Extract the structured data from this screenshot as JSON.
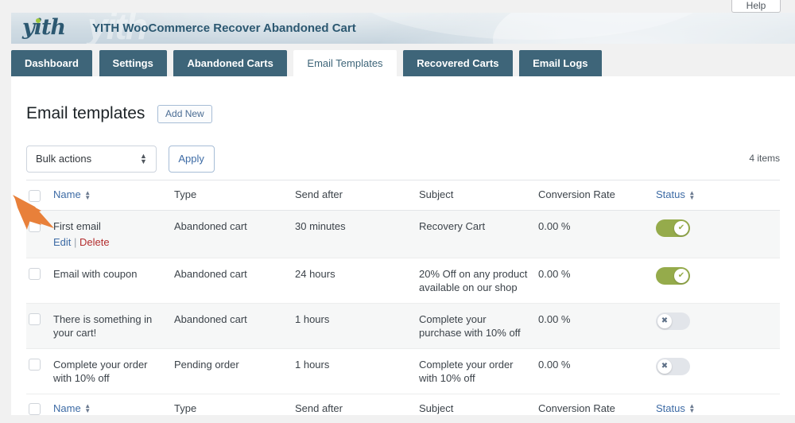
{
  "window": {
    "help_tab_label": "Help"
  },
  "banner": {
    "logo_text": "yith",
    "ghost_text": "yith",
    "title": "YITH WooCommerce Recover Abandoned Cart",
    "logo_color": "#2c5871",
    "logo_dot_color": "#9ec73d"
  },
  "tabs": [
    {
      "label": "Dashboard",
      "active": false
    },
    {
      "label": "Settings",
      "active": false
    },
    {
      "label": "Abandoned Carts",
      "active": false
    },
    {
      "label": "Email Templates",
      "active": true
    },
    {
      "label": "Recovered Carts",
      "active": false
    },
    {
      "label": "Email Logs",
      "active": false
    }
  ],
  "page": {
    "title": "Email templates",
    "add_new_label": "Add New"
  },
  "bulk": {
    "select_value": "Bulk actions",
    "select_icon": "up-down-arrows-icon",
    "apply_label": "Apply",
    "items_count": "4 items"
  },
  "table": {
    "columns": [
      {
        "label": "Name",
        "sortable": true
      },
      {
        "label": "Type",
        "sortable": false
      },
      {
        "label": "Send after",
        "sortable": false
      },
      {
        "label": "Subject",
        "sortable": false
      },
      {
        "label": "Conversion Rate",
        "sortable": false
      },
      {
        "label": "Status",
        "sortable": true
      }
    ],
    "row_actions": {
      "edit_label": "Edit",
      "separator": "|",
      "delete_label": "Delete"
    },
    "rows": [
      {
        "name": "First email",
        "type": "Abandoned cart",
        "send_after": "30 minutes",
        "subject": "Recovery Cart",
        "conversion_rate": "0.00 %",
        "status_on": true,
        "status_icon": "check-icon",
        "has_actions": true
      },
      {
        "name": "Email with coupon",
        "type": "Abandoned cart",
        "send_after": "24 hours",
        "subject": "20% Off on any product available on our shop",
        "conversion_rate": "0.00 %",
        "status_on": true,
        "status_icon": "check-icon",
        "has_actions": false
      },
      {
        "name": "There is something in your cart!",
        "type": "Abandoned cart",
        "send_after": "1 hours",
        "subject": "Complete your purchase with 10% off",
        "conversion_rate": "0.00 %",
        "status_on": false,
        "status_icon": "close-icon",
        "has_actions": false
      },
      {
        "name": "Complete your order with 10% off",
        "type": "Pending order",
        "send_after": "1 hours",
        "subject": "Complete your order with 10% off",
        "conversion_rate": "0.00 %",
        "status_on": false,
        "status_icon": "close-icon",
        "has_actions": false
      }
    ]
  },
  "annotation": {
    "arrow_color": "#e8803a",
    "points_to": "edit-link"
  },
  "colors": {
    "tab_active_bg": "#ffffff",
    "tab_bg": "#3e6579",
    "link": "#3d6ba5",
    "delete_link": "#b32d2e",
    "toggle_on": "#95ab4b",
    "toggle_off": "#e2e5ea"
  }
}
